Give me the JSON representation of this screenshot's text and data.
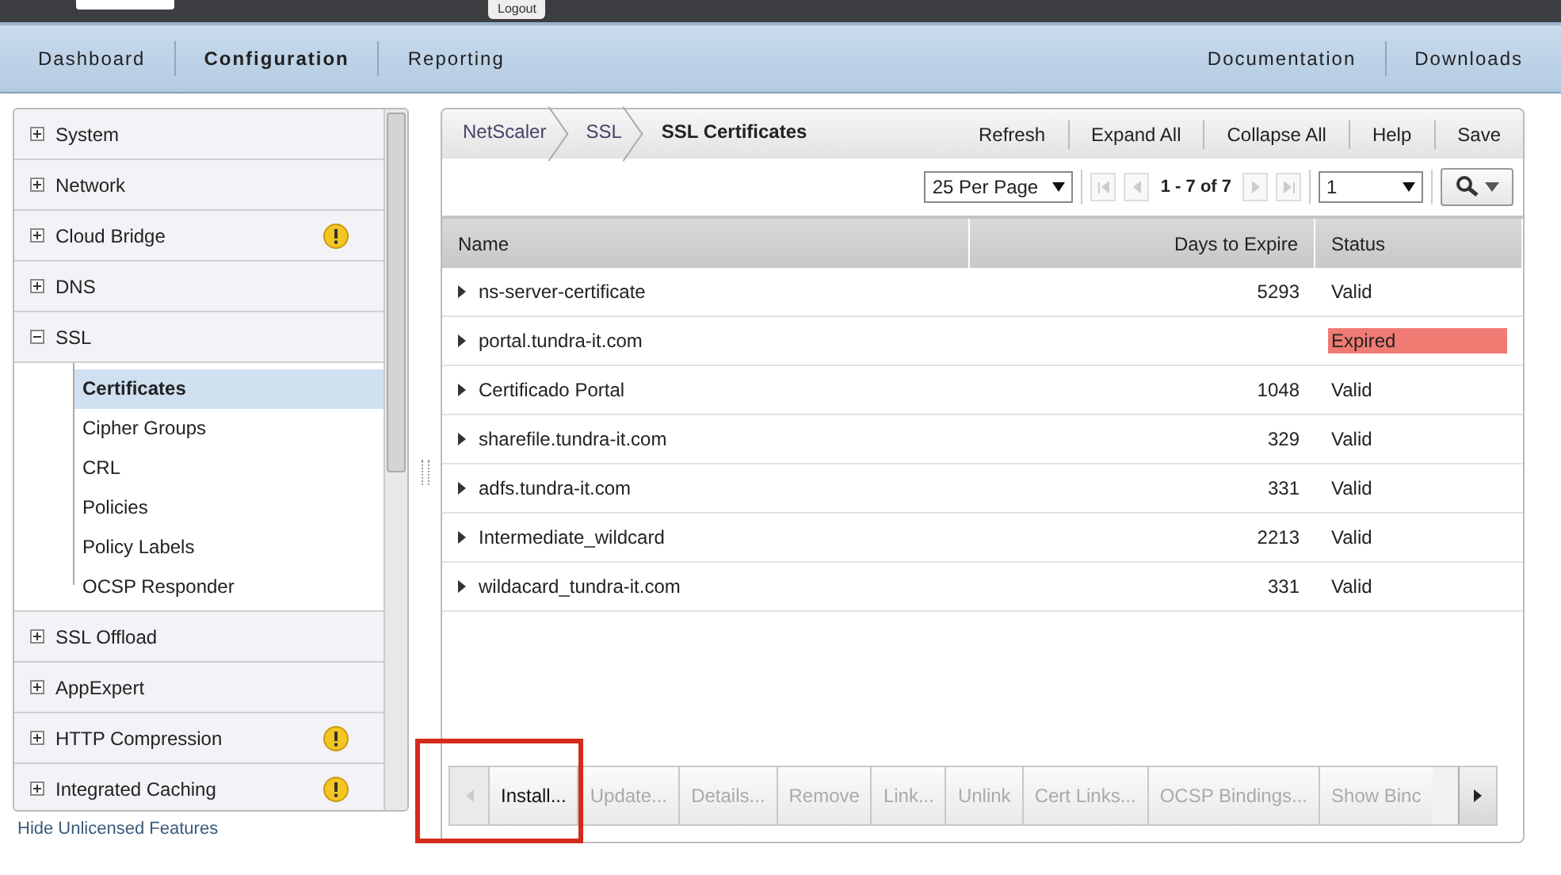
{
  "top_bar": {
    "logout": "Logout"
  },
  "nav_tabs": [
    {
      "label": "Dashboard",
      "selected": false
    },
    {
      "label": "Configuration",
      "selected": true
    },
    {
      "label": "Reporting",
      "selected": false
    }
  ],
  "nav_links": [
    "Documentation",
    "Downloads"
  ],
  "sidebar": {
    "items": [
      {
        "label": "System",
        "expanded": false,
        "warning": false
      },
      {
        "label": "Network",
        "expanded": false,
        "warning": false
      },
      {
        "label": "Cloud Bridge",
        "expanded": false,
        "warning": true
      },
      {
        "label": "DNS",
        "expanded": false,
        "warning": false
      },
      {
        "label": "SSL",
        "expanded": true,
        "warning": false,
        "children": [
          {
            "label": "Certificates",
            "selected": true
          },
          {
            "label": "Cipher Groups",
            "selected": false
          },
          {
            "label": "CRL",
            "selected": false
          },
          {
            "label": "Policies",
            "selected": false
          },
          {
            "label": "Policy Labels",
            "selected": false
          },
          {
            "label": "OCSP Responder",
            "selected": false
          }
        ]
      },
      {
        "label": "SSL Offload",
        "expanded": false,
        "warning": false
      },
      {
        "label": "AppExpert",
        "expanded": false,
        "warning": false
      },
      {
        "label": "HTTP Compression",
        "expanded": false,
        "warning": true
      },
      {
        "label": "Integrated Caching",
        "expanded": false,
        "warning": true
      }
    ],
    "footer_link": "Hide Unlicensed Features"
  },
  "breadcrumb": [
    "NetScaler",
    "SSL",
    "SSL Certificates"
  ],
  "header_actions": [
    "Refresh",
    "Expand All",
    "Collapse All",
    "Help",
    "Save"
  ],
  "paging": {
    "per_page": "25 Per Page",
    "range": "1 - 7 of 7",
    "page": "1"
  },
  "table": {
    "columns": [
      "Name",
      "Days to Expire",
      "Status"
    ],
    "rows": [
      {
        "name": "ns-server-certificate",
        "days": "5293",
        "status": "Valid",
        "expired": false
      },
      {
        "name": "portal.tundra-it.com",
        "status": "Expired",
        "expired": true
      },
      {
        "name": "Certificado Portal",
        "days": "1048",
        "status": "Valid",
        "expired": false
      },
      {
        "name": "sharefile.tundra-it.com",
        "days": "329",
        "status": "Valid",
        "expired": false
      },
      {
        "name": "adfs.tundra-it.com",
        "days": "331",
        "status": "Valid",
        "expired": false
      },
      {
        "name": "Intermediate_wildcard",
        "days": "2213",
        "status": "Valid",
        "expired": false
      },
      {
        "name": "wildacard_tundra-it.com",
        "days": "331",
        "status": "Valid",
        "expired": false
      }
    ]
  },
  "actions": [
    {
      "label": "Install...",
      "disabled": false,
      "highlighted": true
    },
    {
      "label": "Update...",
      "disabled": true,
      "highlighted": false
    },
    {
      "label": "Details...",
      "disabled": true,
      "highlighted": false
    },
    {
      "label": "Remove",
      "disabled": true,
      "highlighted": false
    },
    {
      "label": "Link...",
      "disabled": true,
      "highlighted": false
    },
    {
      "label": "Unlink",
      "disabled": true,
      "highlighted": false
    },
    {
      "label": "Cert Links...",
      "disabled": true,
      "highlighted": false
    },
    {
      "label": "OCSP Bindings...",
      "disabled": true,
      "highlighted": false
    },
    {
      "label": "Show Binc",
      "disabled": true,
      "highlighted": false
    }
  ]
}
